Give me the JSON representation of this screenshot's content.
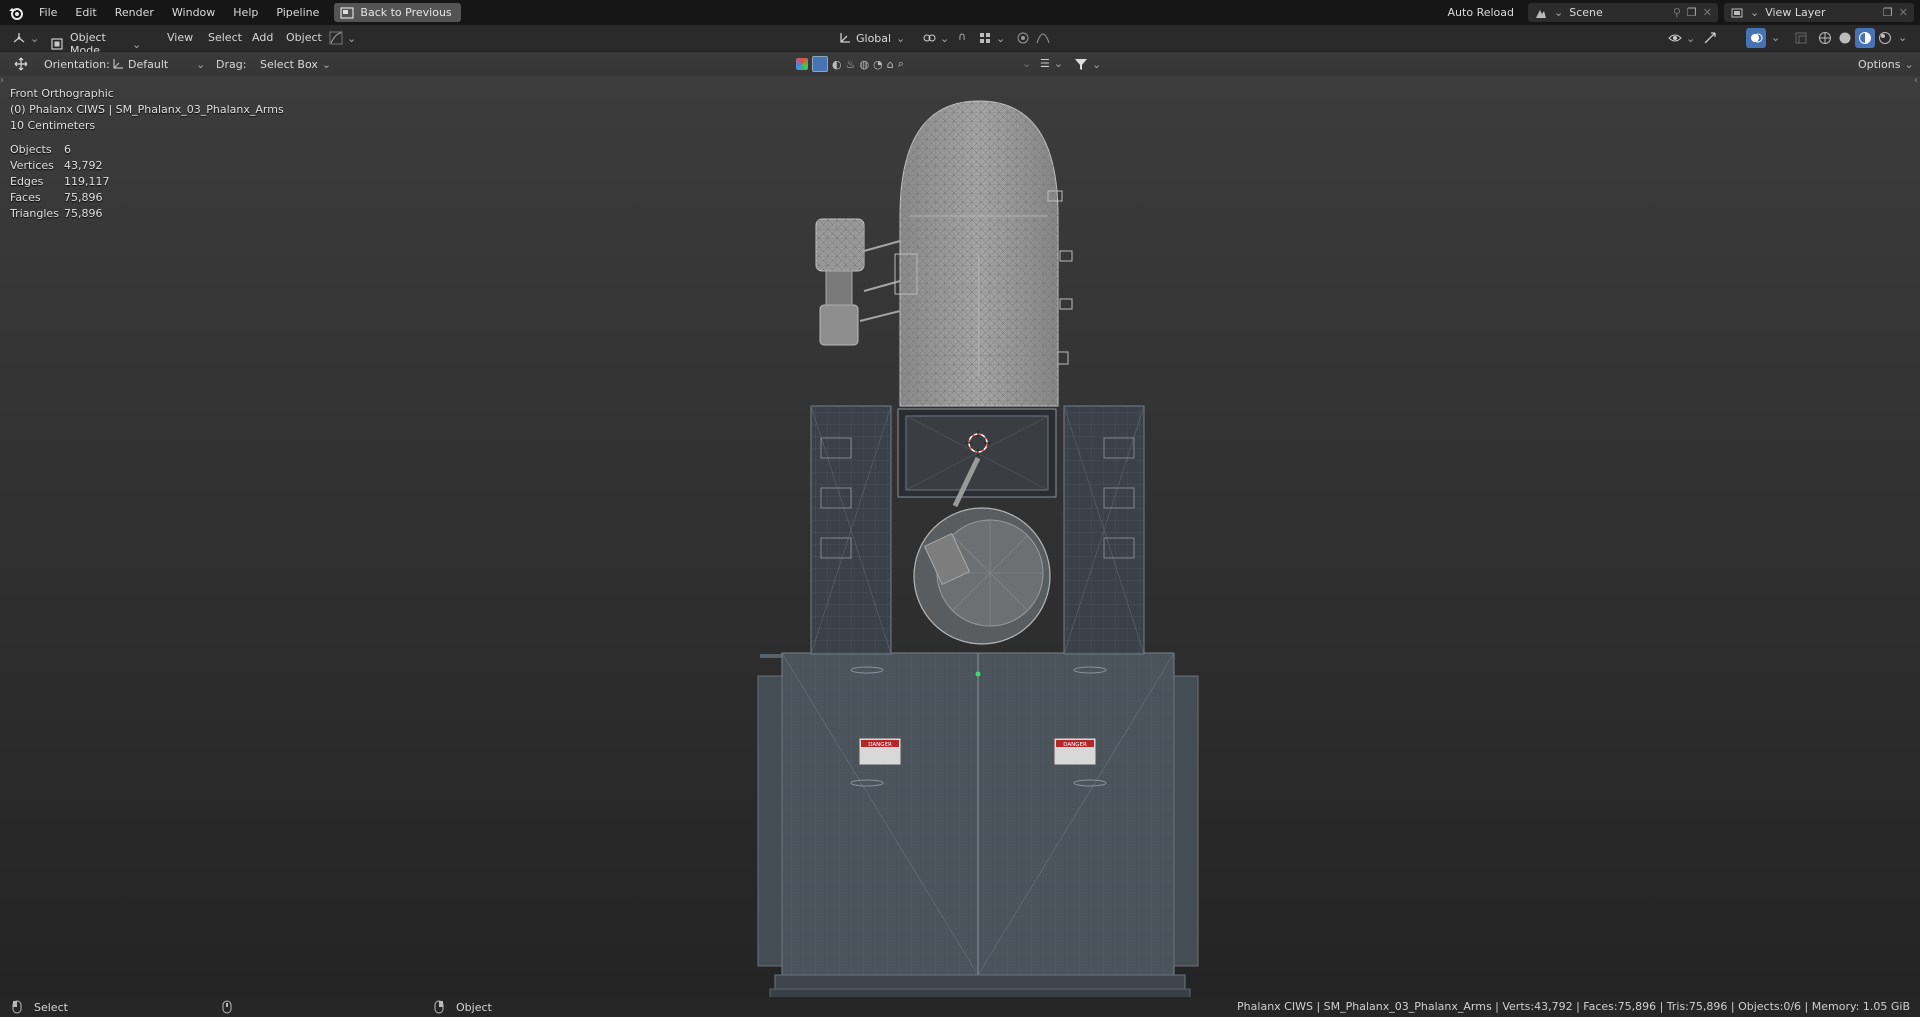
{
  "menubar": {
    "items": [
      "File",
      "Edit",
      "Render",
      "Window",
      "Help",
      "Pipeline"
    ],
    "back_button": "Back to Previous",
    "auto_reload": "Auto Reload",
    "scene": "Scene",
    "view_layer": "View Layer"
  },
  "header": {
    "mode": "Object Mode",
    "menus": [
      "View",
      "Select",
      "Add",
      "Object"
    ],
    "transform_orientation": "Global"
  },
  "toolsettings": {
    "orientation_label": "Orientation:",
    "orientation_value": "Default",
    "drag_label": "Drag:",
    "drag_value": "Select Box",
    "options": "Options"
  },
  "viewport": {
    "view_name": "Front Orthographic",
    "collection_object": "(0) Phalanx CIWS | SM_Phalanx_03_Phalanx_Arms",
    "scale": "10 Centimeters",
    "stats": [
      {
        "label": "Objects",
        "value": "6"
      },
      {
        "label": "Vertices",
        "value": "43,792"
      },
      {
        "label": "Edges",
        "value": "119,117"
      },
      {
        "label": "Faces",
        "value": "75,896"
      },
      {
        "label": "Triangles",
        "value": "75,896"
      }
    ],
    "danger_label": "DANGER"
  },
  "statusbar": {
    "left_action": "Select",
    "right_action": "Object",
    "info": "Phalanx CIWS | SM_Phalanx_03_Phalanx_Arms | Verts:43,792 | Faces:75,896 | Tris:75,896 | Objects:0/6 | Memory: 1.05 GiB"
  },
  "colors": {
    "active_blue": "#4772b3",
    "viewport_top": "#3c3c3c",
    "viewport_bottom": "#242424",
    "model_gray": "#9a9a9a",
    "model_dark": "#4a5158"
  }
}
